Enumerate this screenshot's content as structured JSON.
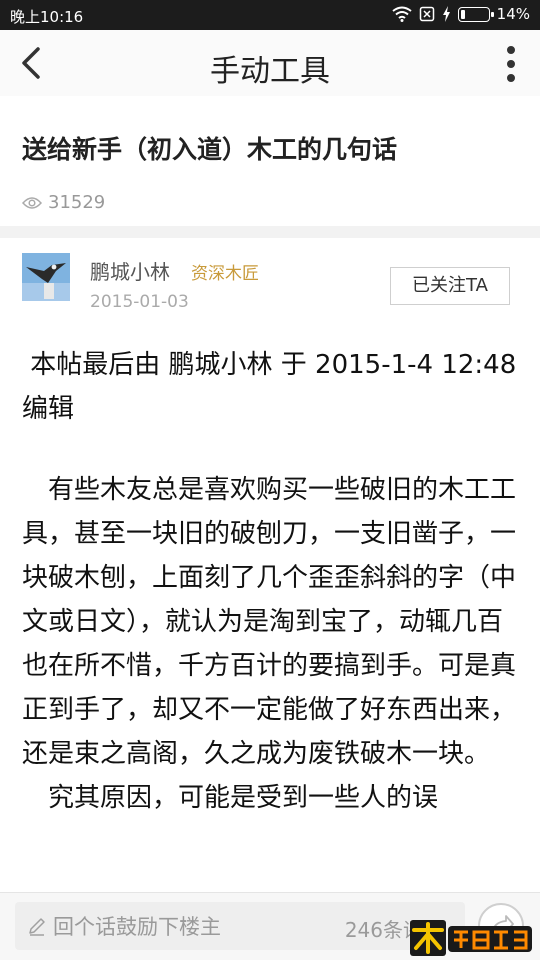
{
  "status_bar": {
    "time": "晚上10:16",
    "battery": "14%",
    "battery_level": 0.14
  },
  "app_bar": {
    "title": "手动工具",
    "back_icon": "chevron-left-icon",
    "more_icon": "more-vertical-icon"
  },
  "post": {
    "title": "送给新手（初入道）木工的几句话",
    "views": "31529",
    "views_icon": "eye-icon"
  },
  "author": {
    "name": "鹏城小林",
    "rank": "资深木匠",
    "date": "2015-01-03",
    "follow_label": "已关注TA"
  },
  "content": {
    "edit_note": " 本帖最后由 鹏城小林 于 2015-1-4 12:48 编辑",
    "paragraph1": "有些木友总是喜欢购买一些破旧的木工工具，甚至一块旧的破刨刀，一支旧凿子，一块破木刨，上面刻了几个歪歪斜斜的字（中文或日文），就认为是淘到宝了，动辄几百也在所不惜，千方百计的要搞到手。可是真正到手了，却又不一定能做了好东西出来，还是束之高阁，久之成为废铁破木一块。",
    "paragraph2": "究其原因，可能是受到一些人的误"
  },
  "bottom_bar": {
    "reply_placeholder": "回个话鼓励下楼主",
    "reply_count": "246条评论",
    "pencil_icon": "pencil-icon",
    "share_icon": "share-icon"
  },
  "watermark": {
    "text": "木工爱好者"
  },
  "colors": {
    "rank": "#c89a3a",
    "status_bar": "#1c1c1c",
    "muted": "#999999"
  }
}
